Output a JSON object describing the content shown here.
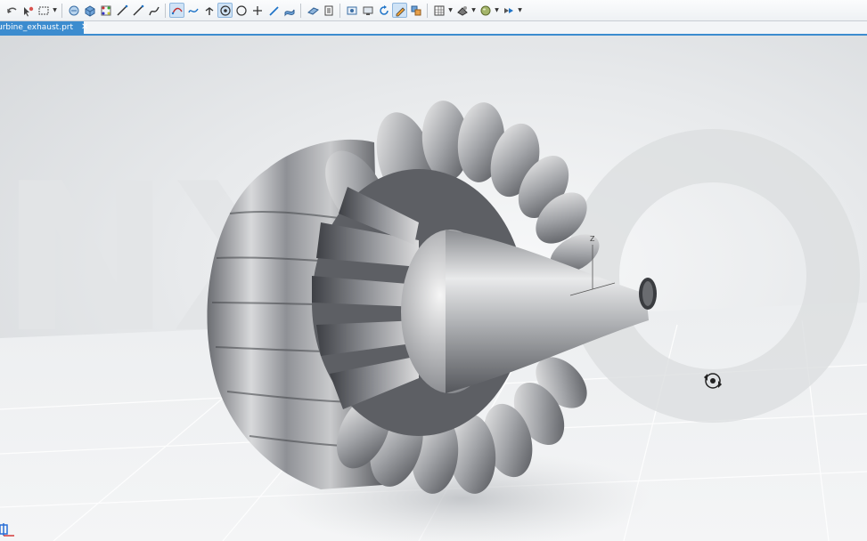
{
  "toolbar": {
    "buttons": [
      {
        "name": "undo-button",
        "icon": "undo-icon"
      },
      {
        "name": "select-filter-button",
        "icon": "select-filter-icon"
      },
      {
        "name": "selection-box-button",
        "icon": "selection-box-icon",
        "dropdown": true
      },
      {
        "name": "sketch-button",
        "icon": "sketch-icon"
      },
      {
        "name": "block-button",
        "icon": "block-icon"
      },
      {
        "name": "point-set-button",
        "icon": "point-set-icon"
      },
      {
        "name": "line-button",
        "icon": "line-icon"
      },
      {
        "name": "line2-button",
        "icon": "line-icon"
      },
      {
        "name": "spline-button",
        "icon": "spline-icon"
      },
      {
        "name": "curve-button",
        "icon": "curve-icon",
        "active": true
      },
      {
        "name": "studio-spline-button",
        "icon": "studio-spline-icon"
      },
      {
        "name": "datum-axis-button",
        "icon": "datum-axis-icon"
      },
      {
        "name": "point-button",
        "icon": "point-icon",
        "active": true
      },
      {
        "name": "circle-button",
        "icon": "circle-icon"
      },
      {
        "name": "cross-button",
        "icon": "cross-icon"
      },
      {
        "name": "pen-button",
        "icon": "pen-icon"
      },
      {
        "name": "surface-button",
        "icon": "surface-icon"
      },
      {
        "name": "plane-button",
        "icon": "plane-icon"
      },
      {
        "name": "layer-button",
        "icon": "layer-icon"
      },
      {
        "name": "view-window-button",
        "icon": "view-window-icon"
      },
      {
        "name": "screen-button",
        "icon": "screen-icon"
      },
      {
        "name": "refresh-button",
        "icon": "refresh-icon"
      },
      {
        "name": "edit-sketch-button",
        "icon": "edit-sketch-icon",
        "active": true
      },
      {
        "name": "group-button",
        "icon": "group-icon"
      },
      {
        "name": "grid-button",
        "icon": "grid-icon",
        "dropdown": true
      },
      {
        "name": "render-style-button",
        "icon": "render-style-icon",
        "dropdown": true
      },
      {
        "name": "sphere-button",
        "icon": "sphere-icon",
        "dropdown": true
      },
      {
        "name": "orient-button",
        "icon": "orient-icon",
        "dropdown": true
      }
    ]
  },
  "tab": {
    "label": "urbine_exhaust.prt",
    "restore_icon": "restore-icon",
    "close_label": "✕"
  },
  "viewport": {
    "model": "turbine-exhaust-model",
    "triad_label": "Z",
    "cursor_icon": "rotate-cursor-icon",
    "colors": {
      "metal_light": "#e6e7e8",
      "metal_dark": "#4b4d52",
      "background": "#e8eaec"
    }
  }
}
